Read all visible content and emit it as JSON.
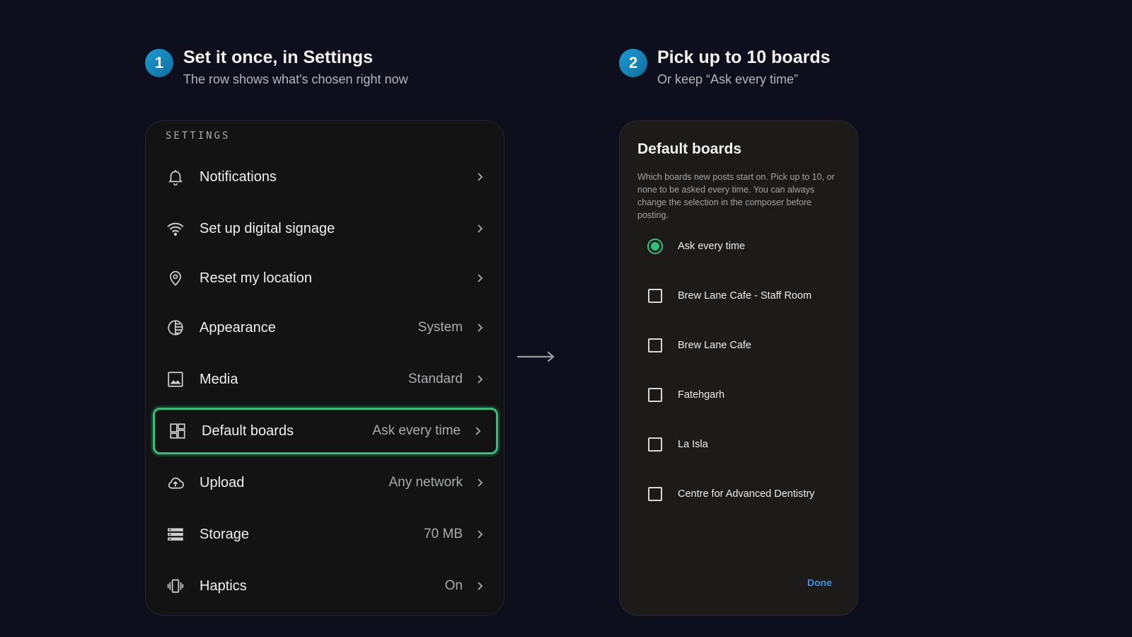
{
  "step1": {
    "number": "1",
    "title": "Set it once, in Settings",
    "subtitle": "The row shows what's chosen right now"
  },
  "step2": {
    "number": "2",
    "title": "Pick up to 10 boards",
    "subtitle": "Or keep “Ask every time”"
  },
  "settings": {
    "section_label": "SETTINGS",
    "rows": [
      {
        "label": "Notifications",
        "value": "",
        "icon": "bell-icon"
      },
      {
        "label": "Set up digital signage",
        "value": "",
        "icon": "wifi-icon"
      },
      {
        "label": "Reset my location",
        "value": "",
        "icon": "location-pin-icon"
      },
      {
        "label": "Appearance",
        "value": "System",
        "icon": "contrast-icon"
      },
      {
        "label": "Media",
        "value": "Standard",
        "icon": "image-icon"
      },
      {
        "label": "Default boards",
        "value": "Ask every time",
        "icon": "dashboard-icon"
      },
      {
        "label": "Upload",
        "value": "Any network",
        "icon": "cloud-upload-icon"
      },
      {
        "label": "Storage",
        "value": "70 MB",
        "icon": "storage-icon"
      },
      {
        "label": "Haptics",
        "value": "On",
        "icon": "vibration-icon"
      }
    ]
  },
  "dialog": {
    "title": "Default boards",
    "description": "Which boards new posts start on. Pick up to 10, or none to be asked every time. You can always change the selection in the composer before posting.",
    "options": [
      {
        "label": "Ask every time",
        "type": "radio",
        "selected": true
      },
      {
        "label": "Brew Lane Cafe - Staff Room",
        "type": "checkbox",
        "selected": false
      },
      {
        "label": "Brew Lane Cafe",
        "type": "checkbox",
        "selected": false
      },
      {
        "label": "Fatehgarh",
        "type": "checkbox",
        "selected": false
      },
      {
        "label": "La Isla",
        "type": "checkbox",
        "selected": false
      },
      {
        "label": "Centre for Advanced Dentistry",
        "type": "checkbox",
        "selected": false
      }
    ],
    "done_label": "Done"
  },
  "colors": {
    "accent_green": "#2ec27e",
    "link_blue": "#3d8fe8",
    "step_badge": "#1b9bd6"
  }
}
